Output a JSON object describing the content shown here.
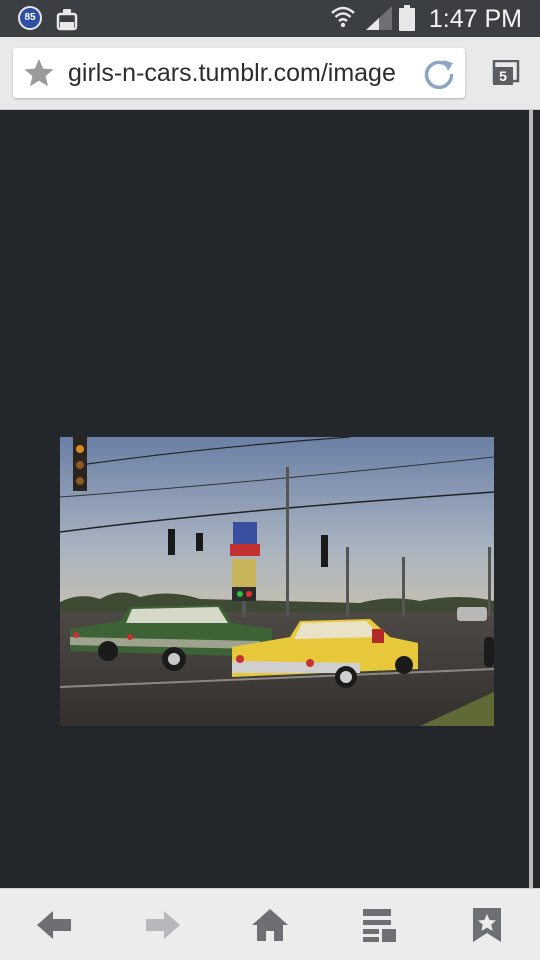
{
  "status_bar": {
    "badge_count": "85",
    "time": "1:47 PM",
    "icons": [
      "notification-badge-icon",
      "clipboard-icon",
      "wifi-icon",
      "signal-icon",
      "battery-icon"
    ]
  },
  "browser": {
    "url": "girls-n-cars.tumblr.com/image",
    "tab_count": "5",
    "icons": [
      "bookmark-star-icon",
      "reload-icon",
      "tabs-icon"
    ]
  },
  "content": {
    "image_subject": "two classic cars at an intersection at sunset"
  },
  "bottom_bar": {
    "icons": [
      "back-arrow-icon",
      "forward-arrow-icon",
      "home-icon",
      "reader-icon",
      "bookmarks-icon"
    ],
    "forward_enabled": false
  },
  "colors": {
    "status_bg": "#3b3e42",
    "toolbar_bg": "#e9e9e9",
    "page_bg": "#23262b",
    "icon_gray": "#6d6f72",
    "reload_blue": "#8aa6c3"
  }
}
